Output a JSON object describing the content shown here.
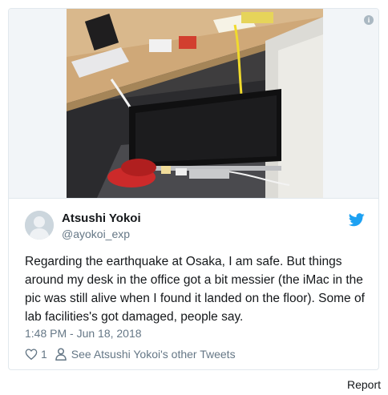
{
  "tweet": {
    "display_name": "Atsushi Yokoi",
    "screen_name": "@ayokoi_exp",
    "text": "Regarding the earthquake at Osaka, I am safe. But things around my desk in the office got a bit messier (the iMac in the pic was still alive when I found it landed on the floor). Some of lab facilities's got damaged, people say.",
    "timestamp": "1:48 PM - Jun 18, 2018",
    "like_count": "1",
    "other_tweets_label": "See Atsushi Yokoi's other Tweets"
  },
  "footer": {
    "report_label": "Report"
  },
  "colors": {
    "twitter_blue": "#1da1f2",
    "muted_gray": "#657786",
    "text_dark": "#14171a",
    "border": "#e1e8ed"
  },
  "icons": [
    "info-icon",
    "twitter-bird-icon",
    "heart-icon",
    "person-icon"
  ]
}
